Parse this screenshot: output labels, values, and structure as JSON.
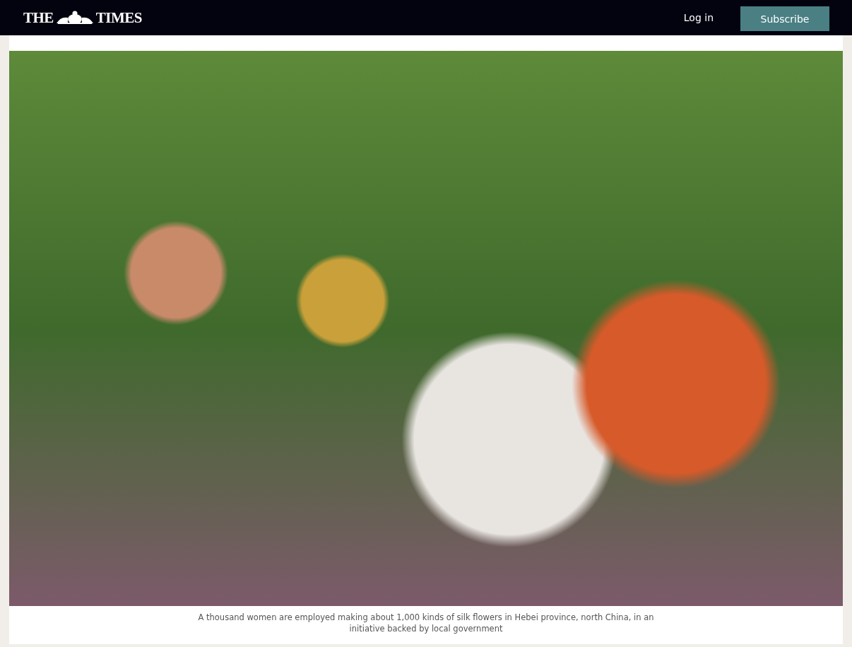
{
  "header": {
    "logo": {
      "left_word": "THE",
      "right_word": "TIMES"
    },
    "login": "Log in",
    "subscribe": "Subscribe"
  },
  "article": {
    "caption": "A thousand women are employed making about 1,000 kinds of silk flowers in Hebei province, north China, in an initiative backed by local government"
  }
}
